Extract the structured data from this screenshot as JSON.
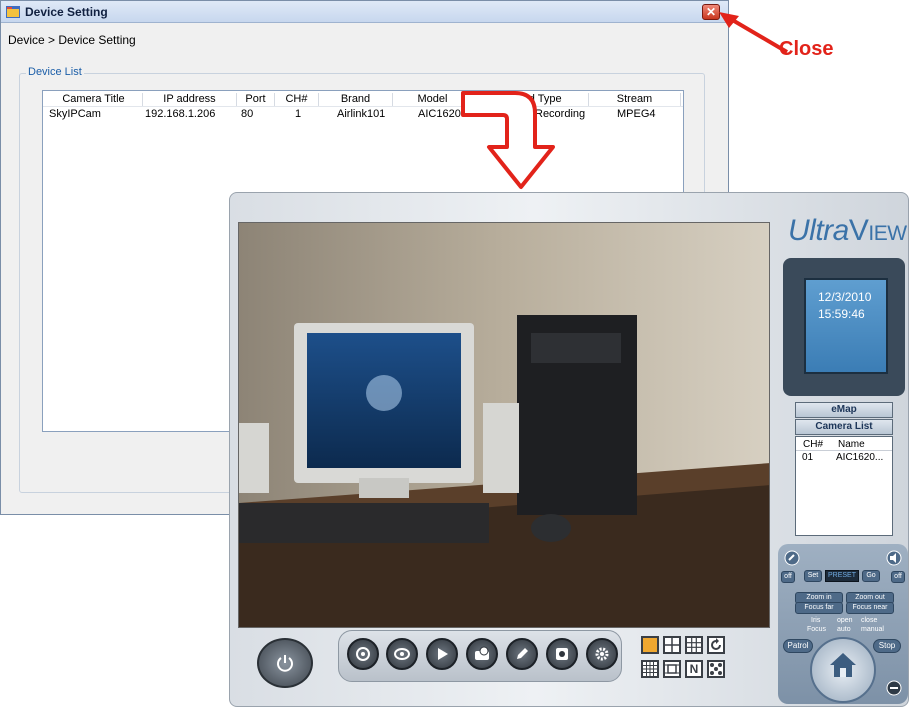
{
  "device_window": {
    "title": "Device Setting",
    "close_glyph": "✕",
    "breadcrumb": "Device > Device Setting",
    "group_label": "Device List",
    "columns": [
      "Camera Title",
      "IP address",
      "Port",
      "CH#",
      "Brand",
      "Model",
      "Record Type",
      "Stream"
    ],
    "rows": [
      {
        "camera_title": "SkyIPCam",
        "ip": "192.168.1.206",
        "port": "80",
        "ch": "1",
        "brand": "Airlink101",
        "model": "AIC1620",
        "record_type": "Recording",
        "stream": "MPEG4"
      }
    ]
  },
  "annotation": {
    "close_label": "Close",
    "arrow_color": "#e2231a"
  },
  "ultraview": {
    "logo_ultra": "Ultra",
    "logo_view": "View",
    "date": "12/3/2010",
    "time": "15:59:46",
    "emap_label": "eMap",
    "camera_list_label": "Camera List",
    "cam_list_header": {
      "ch": "CH#",
      "name": "Name"
    },
    "cam_list_rows": [
      {
        "ch": "01",
        "name": "AIC1620..."
      }
    ],
    "ptz": {
      "off_left": "off",
      "off_right": "off",
      "set": "Set",
      "preset": "PRESET",
      "go": "Go",
      "zoom_in": "Zoom in",
      "zoom_out": "Zoom out",
      "focus_far": "Focus far",
      "focus_near": "Focus near",
      "iris": "Iris",
      "focus": "Focus",
      "open": "open",
      "auto": "auto",
      "close": "close",
      "manual": "manual",
      "patrol": "Patrol",
      "stop": "Stop"
    },
    "layout_n_glyph": "N"
  }
}
